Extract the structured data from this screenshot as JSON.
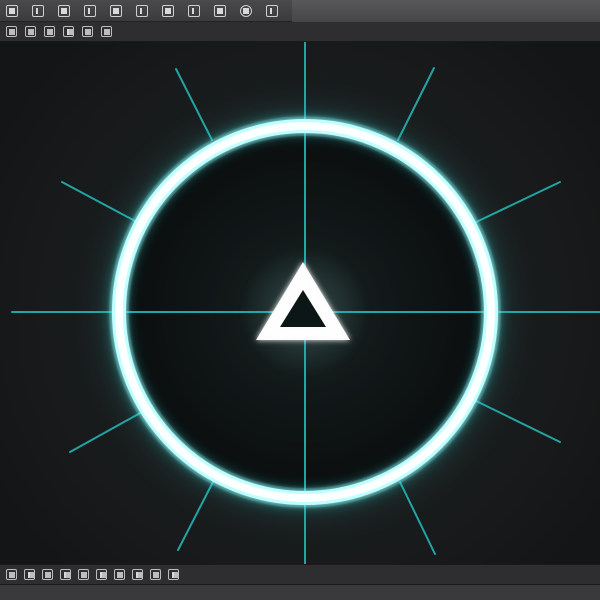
{
  "toolbar_top": {
    "icons": [
      "layout-icon",
      "grid-icon",
      "move-icon",
      "transform-icon",
      "frame-icon",
      "tool-icon",
      "camera-icon",
      "link-icon",
      "render-icon",
      "settings-icon"
    ]
  },
  "toolbar_second": {
    "icons": [
      "view-icon",
      "layer-icon",
      "image-icon",
      "light-icon",
      "grid-view-icon",
      "panel-icon"
    ]
  },
  "toolbar_bottom": {
    "icons": [
      "play-icon",
      "pause-icon",
      "step-icon",
      "record-icon",
      "keyframe-icon",
      "timeline-icon",
      "marker-icon",
      "loop-icon",
      "camera-view-icon",
      "export-icon"
    ]
  },
  "statusbar": {
    "text": ""
  },
  "scene": {
    "accent_color": "#5fe6e6",
    "glow_color": "#21c9c9",
    "shape_color": "#eaffff"
  }
}
